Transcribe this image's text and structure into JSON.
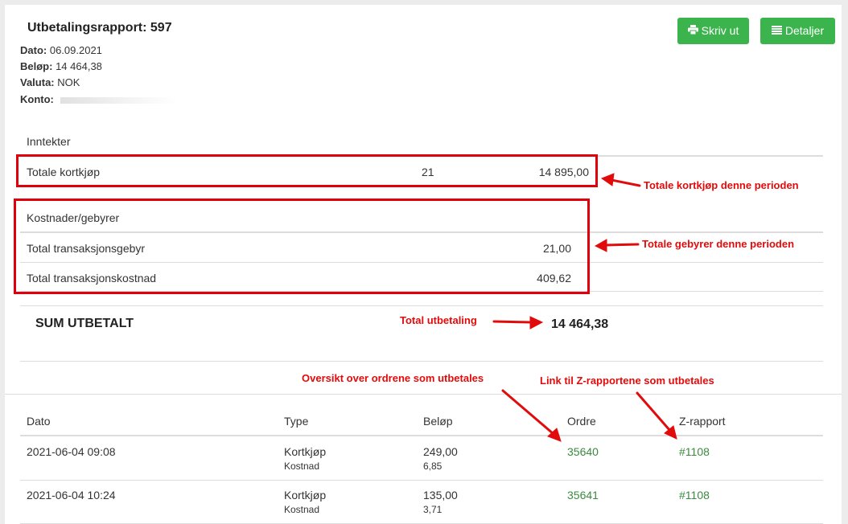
{
  "report": {
    "title": "Utbetalingsrapport: 597",
    "date_label": "Dato:",
    "date_value": "06.09.2021",
    "amount_label": "Beløp:",
    "amount_value": "14 464,38",
    "currency_label": "Valuta:",
    "currency_value": "NOK",
    "account_label": "Konto:"
  },
  "toolbar": {
    "print_label": "Skriv ut",
    "details_label": "Detaljer",
    "accent": "#3cb44e"
  },
  "income": {
    "heading": "Inntekter",
    "row": {
      "label": "Totale kortkjøp",
      "count": "21",
      "amount": "14 895,00"
    }
  },
  "costs": {
    "heading": "Kostnader/gebyrer",
    "rows": [
      {
        "label": "Total transaksjonsgebyr",
        "amount": "21,00"
      },
      {
        "label": "Total transaksjonskostnad",
        "amount": "409,62"
      }
    ]
  },
  "sum": {
    "label": "SUM UTBETALT",
    "value": "14 464,38"
  },
  "annotations": {
    "income": "Totale kortkjøp denne perioden",
    "fees": "Totale gebyrer denne perioden",
    "total": "Total utbetaling",
    "orders": "Oversikt over ordrene som utbetales",
    "zreports": "Link til Z-rapportene som utbetales",
    "color": "#e20b0b"
  },
  "orders_table": {
    "columns": [
      "Dato",
      "Type",
      "Beløp",
      "Ordre",
      "Z-rapport"
    ],
    "rows": [
      {
        "date": "2021-06-04 09:08",
        "type": "Kortkjøp",
        "subtype": "Kostnad",
        "amount": "249,00",
        "subamount": "6,85",
        "order": "35640",
        "zreport": "#1108"
      },
      {
        "date": "2021-06-04 10:24",
        "type": "Kortkjøp",
        "subtype": "Kostnad",
        "amount": "135,00",
        "subamount": "3,71",
        "order": "35641",
        "zreport": "#1108"
      }
    ]
  }
}
